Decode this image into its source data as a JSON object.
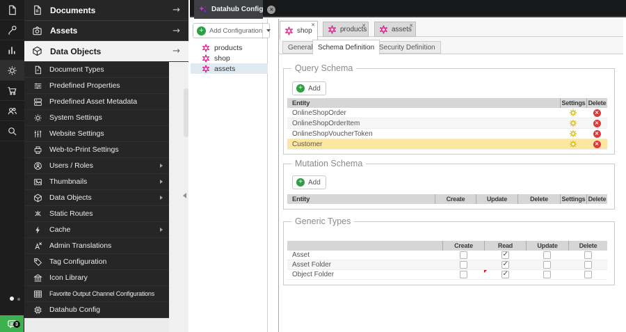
{
  "workspace_tab": {
    "title": "Datahub Config"
  },
  "icon_strip": {
    "badge_count": "3"
  },
  "sidebar": {
    "headers": [
      {
        "label": "Documents"
      },
      {
        "label": "Assets"
      },
      {
        "label": "Data Objects"
      }
    ],
    "items": [
      {
        "label": "Document Types"
      },
      {
        "label": "Predefined Properties"
      },
      {
        "label": "Predefined Asset Metadata"
      },
      {
        "label": "System Settings"
      },
      {
        "label": "Website Settings"
      },
      {
        "label": "Web-to-Print Settings"
      },
      {
        "label": "Users / Roles"
      },
      {
        "label": "Thumbnails"
      },
      {
        "label": "Data Objects"
      },
      {
        "label": "Static Routes"
      },
      {
        "label": "Cache"
      },
      {
        "label": "Admin Translations"
      },
      {
        "label": "Tag Configuration"
      },
      {
        "label": "Icon Library"
      },
      {
        "label": "Favorite Output Channel Configurations"
      },
      {
        "label": "Datahub Config"
      }
    ]
  },
  "config_panel": {
    "add_button_label": "Add Configuration",
    "items": [
      {
        "label": "products"
      },
      {
        "label": "shop"
      },
      {
        "label": "assets"
      }
    ]
  },
  "main": {
    "tabs": [
      {
        "label": "shop"
      },
      {
        "label": "products"
      },
      {
        "label": "assets"
      }
    ],
    "subtabs": [
      {
        "label": "General"
      },
      {
        "label": "Schema Definition"
      },
      {
        "label": "Security Definition"
      }
    ],
    "query_schema": {
      "legend": "Query Schema",
      "add_label": "Add",
      "columns": {
        "entity": "Entity",
        "settings": "Settings",
        "delete": "Delete"
      },
      "rows": [
        {
          "entity": "OnlineShopOrder"
        },
        {
          "entity": "OnlineShopOrderItem"
        },
        {
          "entity": "OnlineShopVoucherToken"
        },
        {
          "entity": "Customer"
        }
      ]
    },
    "mutation_schema": {
      "legend": "Mutation Schema",
      "add_label": "Add",
      "columns": {
        "entity": "Entity",
        "create": "Create",
        "update": "Update",
        "delete": "Delete",
        "settings": "Settings",
        "delete2": "Delete"
      }
    },
    "generic_types": {
      "legend": "Generic Types",
      "columns": {
        "create": "Create",
        "read": "Read",
        "update": "Update",
        "delete": "Delete"
      },
      "rows": [
        {
          "label": "Asset",
          "create": "false",
          "read": "true",
          "update": "false",
          "delete": "false"
        },
        {
          "label": "Asset Folder",
          "create": "false",
          "read": "true",
          "update": "false",
          "delete": "false"
        },
        {
          "label": "Object Folder",
          "create": "false",
          "read": "true",
          "update": "false",
          "delete": "false"
        }
      ]
    }
  }
}
